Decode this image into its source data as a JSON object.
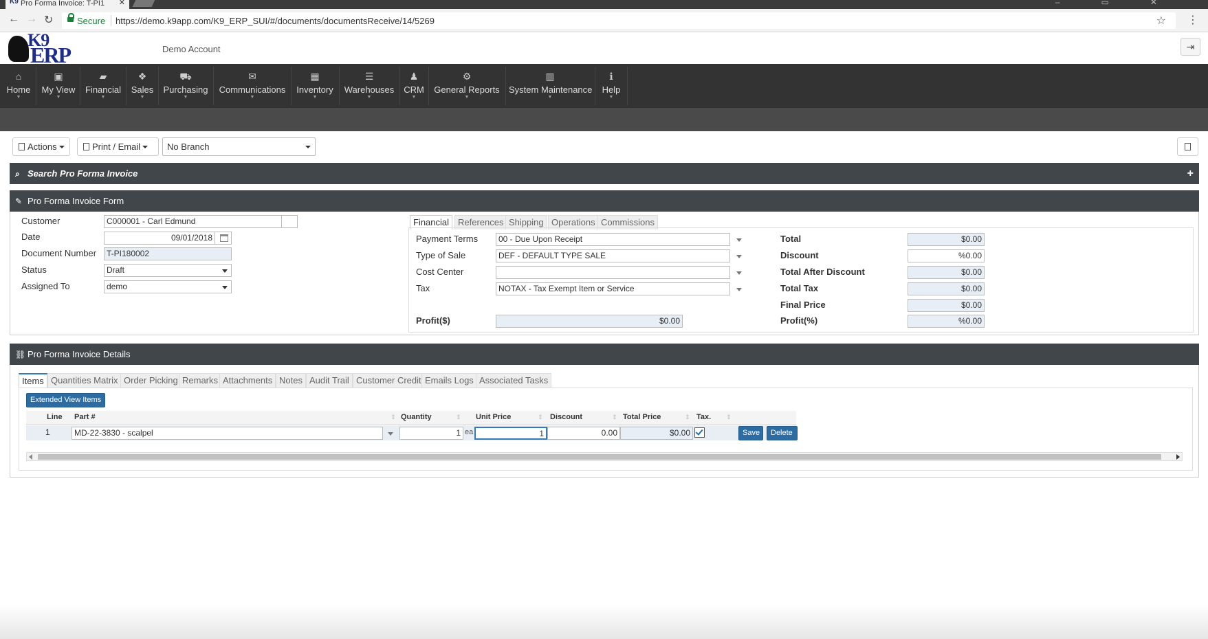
{
  "browser": {
    "tab_title": "Pro Forma Invoice: T-PI1",
    "tab_favicon": "K9",
    "secure_label": "Secure",
    "url": "https://demo.k9app.com/K9_ERP_SUI/#/documents/documentsReceive/14/5269"
  },
  "header": {
    "logo_k9": "K9",
    "logo_erp": "ERP",
    "account_name": "Demo Account"
  },
  "menu": [
    {
      "label": "Home",
      "icon": "home-icon",
      "glyph": "⌂"
    },
    {
      "label": "My View",
      "icon": "briefcase-icon",
      "glyph": "▣"
    },
    {
      "label": "Financial",
      "icon": "book-icon",
      "glyph": "▰"
    },
    {
      "label": "Sales",
      "icon": "cubes-icon",
      "glyph": "❖"
    },
    {
      "label": "Purchasing",
      "icon": "cart-icon",
      "glyph": "⛟"
    },
    {
      "label": "Communications",
      "icon": "envelope-icon",
      "glyph": "✉"
    },
    {
      "label": "Inventory",
      "icon": "grid-icon",
      "glyph": "▦"
    },
    {
      "label": "Warehouses",
      "icon": "warehouse-icon",
      "glyph": "☰"
    },
    {
      "label": "CRM",
      "icon": "users-icon",
      "glyph": "♟"
    },
    {
      "label": "General Reports",
      "icon": "gear-icon",
      "glyph": "⚙"
    },
    {
      "label": "System Maintenance",
      "icon": "bar-chart-icon",
      "glyph": "▥"
    },
    {
      "label": "Help",
      "icon": "info-icon",
      "glyph": "ℹ"
    }
  ],
  "toolbar": {
    "actions_label": "Actions",
    "print_label": "Print / Email",
    "branch_value": "No Branch"
  },
  "search_panel": {
    "title": "Search Pro Forma Invoice"
  },
  "form_panel": {
    "title": "Pro Forma Invoice Form",
    "customer_label": "Customer",
    "customer_value": "C000001 - Carl Edmund",
    "date_label": "Date",
    "date_value": "09/01/2018",
    "docnum_label": "Document Number",
    "docnum_value": "T-PI180002",
    "status_label": "Status",
    "status_value": "Draft",
    "assigned_label": "Assigned To",
    "assigned_value": "demo",
    "tabs": [
      "Financial",
      "References",
      "Shipping",
      "Operations",
      "Commissions"
    ],
    "financial": {
      "payment_terms_label": "Payment Terms",
      "payment_terms_value": "00 - Due Upon Receipt",
      "type_of_sale_label": "Type of Sale",
      "type_of_sale_value": "DEF - DEFAULT TYPE SALE",
      "cost_center_label": "Cost Center",
      "cost_center_value": "",
      "tax_label": "Tax",
      "tax_value": "NOTAX - Tax Exempt Item or Service",
      "profit_label": "Profit($)",
      "profit_value": "$0.00",
      "total_label": "Total",
      "total_value": "$0.00",
      "discount_label": "Discount",
      "discount_value": "%0.00",
      "total_after_discount_label": "Total After Discount",
      "total_after_discount_value": "$0.00",
      "total_tax_label": "Total Tax",
      "total_tax_value": "$0.00",
      "final_price_label": "Final Price",
      "final_price_value": "$0.00",
      "profit_pct_label": "Profit(%)",
      "profit_pct_value": "%0.00"
    }
  },
  "details_panel": {
    "title": "Pro Forma Invoice Details",
    "tabs": [
      "Items",
      "Quantities Matrix",
      "Order Picking",
      "Remarks",
      "Attachments",
      "Notes",
      "Audit Trail",
      "Customer Credit",
      "Emails Logs",
      "Associated Tasks"
    ],
    "extended_view_label": "Extended View Items",
    "columns": [
      "Line",
      "Part #",
      "Quantity",
      "Unit Price",
      "Discount",
      "Total Price",
      "Tax."
    ],
    "row": {
      "line": "1",
      "part": "MD-22-3830 - scalpel",
      "quantity": "1",
      "unit": "ea",
      "unit_price": "1",
      "discount": "0.00",
      "total_price": "$0.00",
      "tax_checked": true,
      "save_label": "Save",
      "delete_label": "Delete"
    }
  }
}
